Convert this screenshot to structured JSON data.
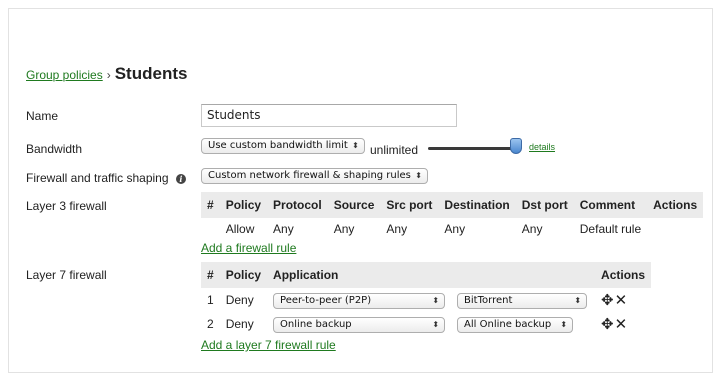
{
  "breadcrumb": {
    "parent": "Group policies",
    "separator": "›",
    "title": "Students"
  },
  "fields": {
    "name_label": "Name",
    "name_value": "Students",
    "bandwidth_label": "Bandwidth",
    "bandwidth_select": "Use custom bandwidth limit",
    "bandwidth_value": "unlimited",
    "bandwidth_slider_level": 1.0,
    "details_link": "details",
    "firewall_label": "Firewall and traffic shaping",
    "firewall_select": "Custom network firewall & shaping rules",
    "layer3_label": "Layer 3 firewall",
    "layer7_label": "Layer 7 firewall"
  },
  "layer3": {
    "headers": [
      "#",
      "Policy",
      "Protocol",
      "Source",
      "Src port",
      "Destination",
      "Dst port",
      "Comment",
      "Actions"
    ],
    "rows": [
      {
        "num": "",
        "policy": "Allow",
        "protocol": "Any",
        "source": "Any",
        "src_port": "Any",
        "destination": "Any",
        "dst_port": "Any",
        "comment": "Default rule",
        "actions": ""
      }
    ],
    "add_link": "Add a firewall rule"
  },
  "layer7": {
    "headers": [
      "#",
      "Policy",
      "Application",
      "",
      "Actions"
    ],
    "rows": [
      {
        "num": "1",
        "policy": "Deny",
        "category": "Peer-to-peer (P2P)",
        "application": "BitTorrent"
      },
      {
        "num": "2",
        "policy": "Deny",
        "category": "Online backup",
        "application": "All Online backup"
      }
    ],
    "add_link": "Add a layer 7 firewall rule"
  },
  "icons": {
    "select_arrow": "⬍",
    "move": "✥",
    "delete": "✕",
    "info": "i"
  },
  "colors": {
    "link": "#1f7a1f",
    "header_bg": "#ebebeb",
    "slider_thumb": "#4a87cf"
  }
}
